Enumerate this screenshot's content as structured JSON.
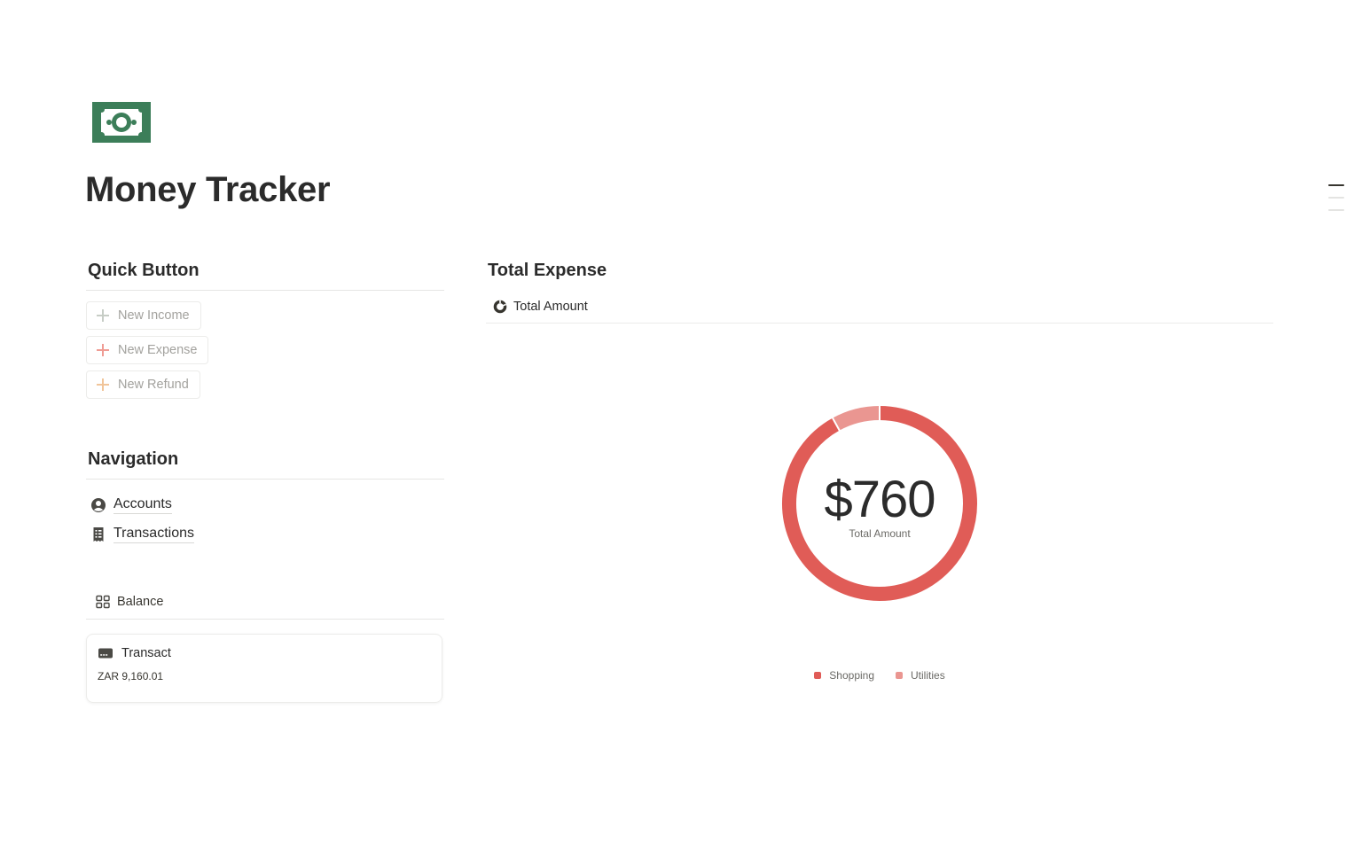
{
  "page": {
    "title": "Money Tracker",
    "icon": "money-bill-icon"
  },
  "quick_buttons": {
    "heading": "Quick Button",
    "items": [
      {
        "label": "New Income",
        "icon": "plus-icon",
        "color": "#c7cdc6"
      },
      {
        "label": "New Expense",
        "icon": "plus-icon",
        "color": "#ef9c94"
      },
      {
        "label": "New Refund",
        "icon": "plus-icon",
        "color": "#f1c59a"
      }
    ]
  },
  "navigation": {
    "heading": "Navigation",
    "items": [
      {
        "label": "Accounts",
        "icon": "user-circle-icon"
      },
      {
        "label": "Transactions",
        "icon": "receipt-icon"
      }
    ]
  },
  "balance": {
    "view_label": "Balance",
    "view_icon": "gallery-icon",
    "card": {
      "title": "Transact",
      "icon": "credit-card-icon",
      "value": "ZAR 9,160.01"
    }
  },
  "total_expense": {
    "heading": "Total Expense",
    "view_tab": "Total Amount",
    "view_icon": "donut-chart-icon"
  },
  "chart_data": {
    "type": "pie",
    "style": "donut",
    "center_value": "$760",
    "center_label": "Total Amount",
    "legend_position": "bottom",
    "series": [
      {
        "name": "Shopping",
        "fraction": 0.92,
        "color": "#e05c57"
      },
      {
        "name": "Utilities",
        "fraction": 0.08,
        "color": "#ea9691"
      }
    ]
  },
  "colors": {
    "brand_green": "#3c7e59"
  }
}
